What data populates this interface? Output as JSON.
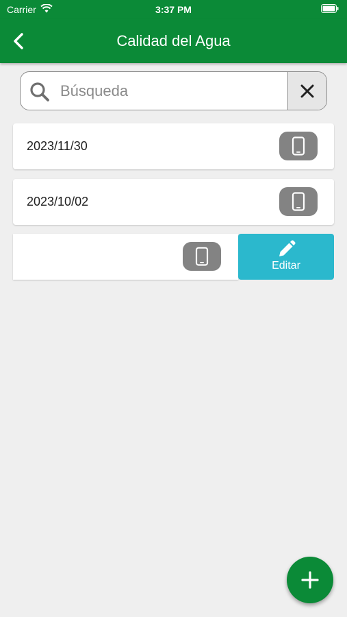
{
  "status_bar": {
    "carrier": "Carrier",
    "time": "3:37 PM"
  },
  "nav": {
    "title": "Calidad del Agua"
  },
  "search": {
    "placeholder": "Búsqueda",
    "value": ""
  },
  "records": [
    {
      "date": "2023/11/30"
    },
    {
      "date": "2023/10/02"
    }
  ],
  "swipe_action": {
    "label": "Editar"
  },
  "colors": {
    "primary": "#0b8a37",
    "edit": "#2bb8cd",
    "device_button": "#838383"
  }
}
